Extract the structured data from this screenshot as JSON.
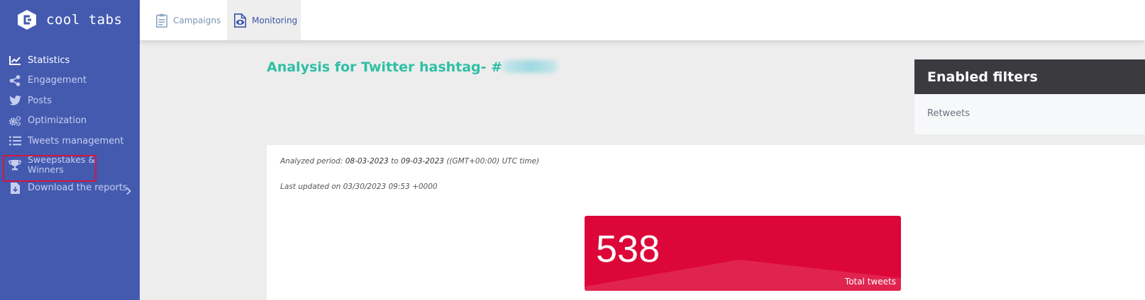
{
  "brand": {
    "name": "cool tabs"
  },
  "sidebar": {
    "items": [
      {
        "label": "Statistics",
        "icon": "chart-line-icon",
        "active": true
      },
      {
        "label": "Engagement",
        "icon": "share-icon"
      },
      {
        "label": "Posts",
        "icon": "twitter-icon"
      },
      {
        "label": "Optimization",
        "icon": "gears-icon"
      },
      {
        "label": "Tweets management",
        "icon": "list-icon"
      },
      {
        "label": "Sweepstakes & Winners",
        "icon": "trophy-icon",
        "highlighted": true
      },
      {
        "label": "Download the reports",
        "icon": "download-file-icon",
        "has_submenu": true
      }
    ]
  },
  "topbar": {
    "tabs": [
      {
        "label": "Campaigns",
        "icon": "clipboard-icon"
      },
      {
        "label": "Monitoring",
        "icon": "eye-document-icon",
        "active": true
      }
    ]
  },
  "main": {
    "title": "Analysis for Twitter hashtag- #",
    "meta": {
      "period_prefix": "Analyzed period: ",
      "period_from": "08-03-2023",
      "period_to_word": " to ",
      "period_to": "09-03-2023",
      "period_tz": " ((GMT+00:00) UTC time)",
      "last_updated": "Last updated on 03/30/2023 09:53 +0000"
    },
    "stat": {
      "value": "538",
      "label": "Total tweets"
    }
  },
  "filters": {
    "title": "Enabled filters",
    "items": [
      "Retweets"
    ]
  },
  "colors": {
    "sidebar": "#435aaf",
    "accent_teal": "#2fbfa5",
    "stat_red": "#dc0639",
    "filters_header": "#3b3a3f",
    "highlight_border": "#d6163f"
  }
}
